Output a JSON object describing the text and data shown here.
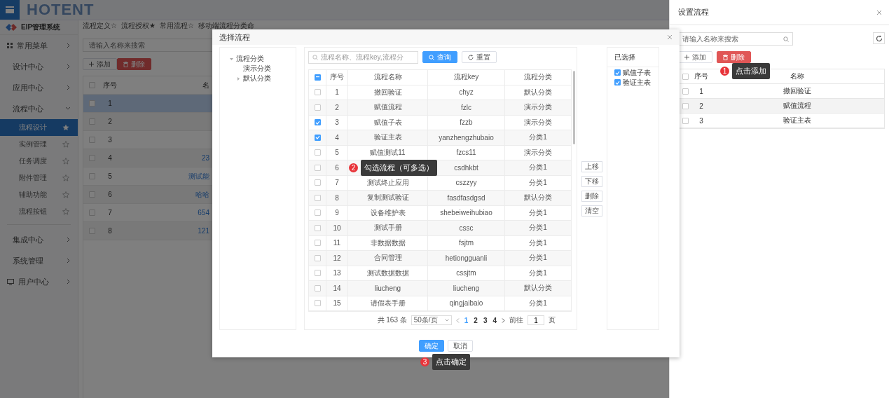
{
  "app": {
    "logo": "HOTENT",
    "system": "EIP管理系统"
  },
  "sidebar": {
    "items": [
      {
        "label": "常用菜单",
        "kind": "grid",
        "expanded": false
      },
      {
        "label": "设计中心",
        "kind": "plain",
        "expanded": false
      },
      {
        "label": "应用中心",
        "kind": "plain",
        "expanded": false
      },
      {
        "label": "流程中心",
        "kind": "plain",
        "expanded": true,
        "children": [
          {
            "label": "流程设计",
            "selected": true,
            "starred": true
          },
          {
            "label": "实例管理",
            "selected": false,
            "starred": false
          },
          {
            "label": "任务调度",
            "selected": false,
            "starred": false
          },
          {
            "label": "附件管理",
            "selected": false,
            "starred": false
          },
          {
            "label": "辅助功能",
            "selected": false,
            "starred": false
          },
          {
            "label": "流程按钮",
            "selected": false,
            "starred": false
          }
        ]
      },
      {
        "label": "集成中心",
        "kind": "plain",
        "expanded": false
      },
      {
        "label": "系统管理",
        "kind": "plain",
        "expanded": false
      },
      {
        "label": "用户中心",
        "kind": "monitor",
        "expanded": false
      }
    ]
  },
  "tabs": [
    {
      "label": "流程定义☆"
    },
    {
      "label": "流程授权★"
    },
    {
      "label": "常用流程☆"
    },
    {
      "label": "移动端流程分类命"
    }
  ],
  "main": {
    "search": {
      "placeholder": "请输入名称来搜索"
    },
    "add_button": "添加",
    "delete_button": "删除",
    "table": {
      "all_checked": false,
      "columns": [
        "序号",
        "名"
      ],
      "rows": [
        {
          "index": "1",
          "selected": true,
          "checked": false
        },
        {
          "index": "2",
          "selected": false,
          "checked": false
        },
        {
          "index": "3",
          "selected": false,
          "checked": false
        },
        {
          "index": "4",
          "name": "23",
          "selected": false,
          "checked": false
        },
        {
          "index": "5",
          "name": "测试能",
          "selected": false,
          "checked": false
        },
        {
          "index": "6",
          "name": "哈哈",
          "selected": false,
          "checked": false
        },
        {
          "index": "7",
          "name": "654",
          "selected": false,
          "checked": false
        },
        {
          "index": "8",
          "name": "121",
          "selected": false,
          "checked": false
        }
      ]
    }
  },
  "drawer": {
    "title": "设置流程",
    "search": {
      "placeholder": "请输入名称来搜索"
    },
    "add_button": "添加",
    "delete_button": "删除",
    "table": {
      "all_checked": false,
      "columns": [
        "序号",
        "名称"
      ],
      "rows": [
        {
          "index": "1",
          "name": "撤回验证",
          "checked": false
        },
        {
          "index": "2",
          "name": "赋值流程",
          "checked": false
        },
        {
          "index": "3",
          "name": "验证主表",
          "checked": false
        }
      ]
    }
  },
  "dialog": {
    "title": "选择流程",
    "tree": [
      {
        "label": "流程分类",
        "expanded": true,
        "children": [
          {
            "label": "演示分类"
          },
          {
            "label": "默认分类",
            "expanded": false
          }
        ]
      }
    ],
    "search": {
      "placeholder": "流程名称、流程key,流程分"
    },
    "query_button": "查询",
    "reset_button": "重置",
    "table": {
      "indeterminate": true,
      "columns": [
        "序号",
        "流程名称",
        "流程key",
        "流程分类"
      ],
      "rows": [
        {
          "index": "1",
          "name": "撤回验证",
          "key": "chyz",
          "category": "默认分类",
          "checked": false
        },
        {
          "index": "2",
          "name": "赋值流程",
          "key": "fzlc",
          "category": "演示分类",
          "checked": false
        },
        {
          "index": "3",
          "name": "赋值子表",
          "key": "fzzb",
          "category": "演示分类",
          "checked": true
        },
        {
          "index": "4",
          "name": "验证主表",
          "key": "yanzhengzhubaio",
          "category": "分类1",
          "checked": true
        },
        {
          "index": "5",
          "name": "赋值测试11",
          "key": "fzcs11",
          "category": "演示分类",
          "checked": false
        },
        {
          "index": "6",
          "key": "csdhkbt",
          "category": "分类1",
          "checked": false
        },
        {
          "index": "7",
          "name": "测试终止应用",
          "key": "cszzyy",
          "category": "分类1",
          "checked": false
        },
        {
          "index": "8",
          "name": "复制测试验证",
          "key": "fasdfasdgsd",
          "category": "默认分类",
          "checked": false
        },
        {
          "index": "9",
          "name": "设备维护表",
          "key": "shebeiweihubiao",
          "category": "分类1",
          "checked": false
        },
        {
          "index": "10",
          "name": "测试手册",
          "key": "cssc",
          "category": "分类1",
          "checked": false
        },
        {
          "index": "11",
          "name": "非数据数据",
          "key": "fsjtm",
          "category": "分类1",
          "checked": false
        },
        {
          "index": "12",
          "name": "合同管理",
          "key": "hetiongguanli",
          "category": "分类1",
          "checked": false
        },
        {
          "index": "13",
          "name": "测试数据数据",
          "key": "cssjtm",
          "category": "分类1",
          "checked": false
        },
        {
          "index": "14",
          "name": "liucheng",
          "key": "liucheng",
          "category": "默认分类",
          "checked": false
        },
        {
          "index": "15",
          "name": "请假表手册",
          "key": "qingjaibaio",
          "category": "分类1",
          "checked": false
        }
      ]
    },
    "pagination": {
      "total": "共 163 条",
      "page_size": "50条/页",
      "pages": [
        {
          "label": "1",
          "selected": true
        },
        {
          "label": "2",
          "selected": false
        },
        {
          "label": "3",
          "selected": false
        },
        {
          "label": "4",
          "selected": false
        }
      ],
      "goto_label": "前往",
      "goto_value": "1",
      "goto_suffix": "页"
    },
    "move_buttons": [
      "上移",
      "下移",
      "删除",
      "清空"
    ],
    "selected_title": "已选择",
    "selected_items": [
      {
        "label": "赋值子表",
        "checked": true
      },
      {
        "label": "验证主表",
        "checked": true
      }
    ],
    "confirm_button": "确定",
    "cancel_button": "取消"
  },
  "tooltips": [
    {
      "number": "1",
      "text": "点击添加"
    },
    {
      "number": "2",
      "text": "勾选流程（可多选）"
    },
    {
      "number": "3",
      "text": "点击确定"
    }
  ]
}
